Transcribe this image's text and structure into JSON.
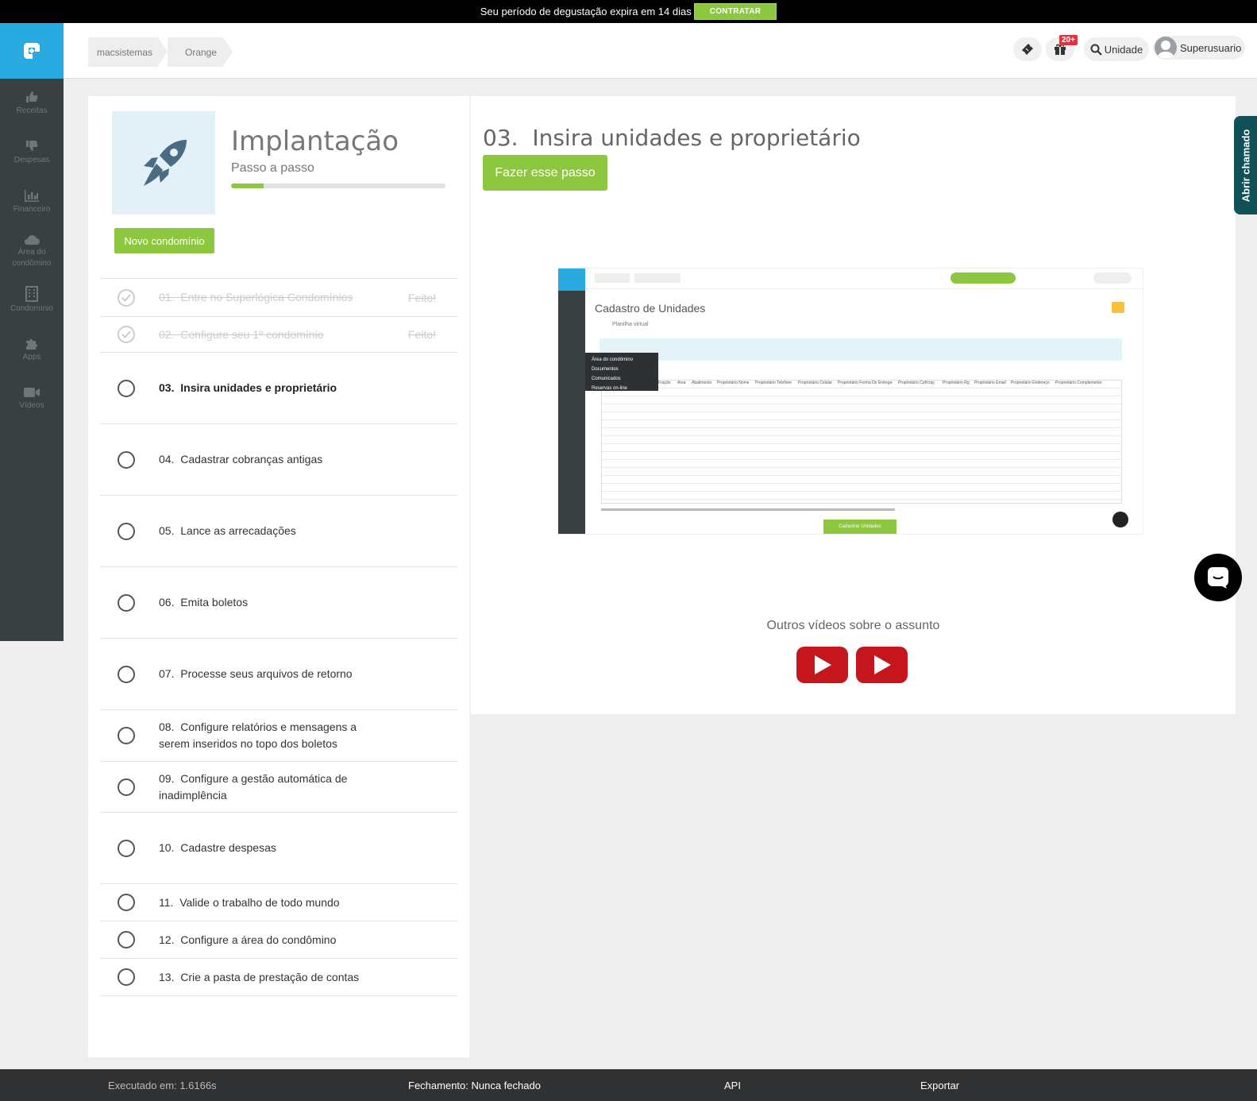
{
  "trial_bar": {
    "message": "Seu período de degustação expira em 14 dias",
    "cta": "CONTRATAR"
  },
  "sidebar": {
    "items": [
      {
        "label": "Receitas",
        "icon": "thumbs-up-icon"
      },
      {
        "label": "Despesas",
        "icon": "thumbs-down-icon"
      },
      {
        "label": "Financeiro",
        "icon": "bar-chart-icon"
      },
      {
        "label": "Área do condômino",
        "icon": "cloud-icon"
      },
      {
        "label": "Condomínio",
        "icon": "building-icon"
      },
      {
        "label": "Apps",
        "icon": "puzzle-icon"
      },
      {
        "label": "Vídeos",
        "icon": "video-camera-icon"
      }
    ]
  },
  "header": {
    "breadcrumb": [
      "macsistemas",
      "Orange"
    ],
    "notification_badge": "20+",
    "search_label": "Unidade",
    "user_name": "Superusuario"
  },
  "implantacao": {
    "title": "Implantação",
    "subtitle": "Passo a passo",
    "progress": 0.15,
    "new_button": "Novo condomínio",
    "done_label": "Feito!",
    "steps": [
      {
        "number": "01.",
        "label": "Entre no Superlógica Condomínios",
        "status": "done"
      },
      {
        "number": "02.",
        "label": "Configure seu 1º condomínio",
        "status": "done"
      },
      {
        "number": "03.",
        "label": "Insira unidades e proprietário",
        "status": "active"
      },
      {
        "number": "04.",
        "label": "Cadastrar cobranças antigas",
        "status": "pending"
      },
      {
        "number": "05.",
        "label": "Lance as arrecadações",
        "status": "pending"
      },
      {
        "number": "06.",
        "label": "Emita boletos",
        "status": "pending"
      },
      {
        "number": "07.",
        "label": "Processe seus arquivos de retorno",
        "status": "pending"
      },
      {
        "number": "08.",
        "label": "Configure relatórios e mensagens a serem inseridos no topo dos boletos",
        "status": "pending"
      },
      {
        "number": "09.",
        "label": "Configure a gestão automática de inadimplência",
        "status": "pending"
      },
      {
        "number": "10.",
        "label": "Cadastre despesas",
        "status": "pending"
      },
      {
        "number": "11.",
        "label": "Valide o trabalho de todo mundo",
        "status": "pending"
      },
      {
        "number": "12.",
        "label": "Configure a área do condômino",
        "status": "pending"
      },
      {
        "number": "13.",
        "label": "Crie a pasta de prestação de contas",
        "status": "pending"
      }
    ]
  },
  "step_detail": {
    "number": "03.",
    "title": "Insira unidades e proprietário",
    "action_button": "Fazer esse passo",
    "video": {
      "screen_title": "Cadastro de Unidades",
      "section": "Planilha virtual",
      "menu": [
        "Área do condômino",
        "Documentos",
        "Comunicados",
        "Reservas on-line"
      ],
      "columns": [
        "Fração",
        "Área",
        "Abatimento",
        "Proprietário Nome",
        "Proprietário Telefone",
        "Proprietário Celular",
        "Proprietário Forma De Entrega",
        "Proprietário Cpf/cnpj",
        "Proprietário Rg",
        "Proprietário Email",
        "Proprietário Endereço",
        "Proprietário Complemento"
      ],
      "submit_label": "Cadastrar Unidades"
    },
    "more_videos": "Outros vídeos sobre o assunto"
  },
  "side_tab": "Abrir chamado",
  "footer": {
    "executed": "Executado em: 1.6166s",
    "closing": "Fechamento: Nunca fechado",
    "api": "API",
    "export": "Exportar"
  },
  "colors": {
    "brand_blue": "#29abe2",
    "green": "#8dc63f",
    "sidebar": "#3a4042",
    "youtube_red": "#c4161c",
    "side_tab": "#0f5157"
  }
}
